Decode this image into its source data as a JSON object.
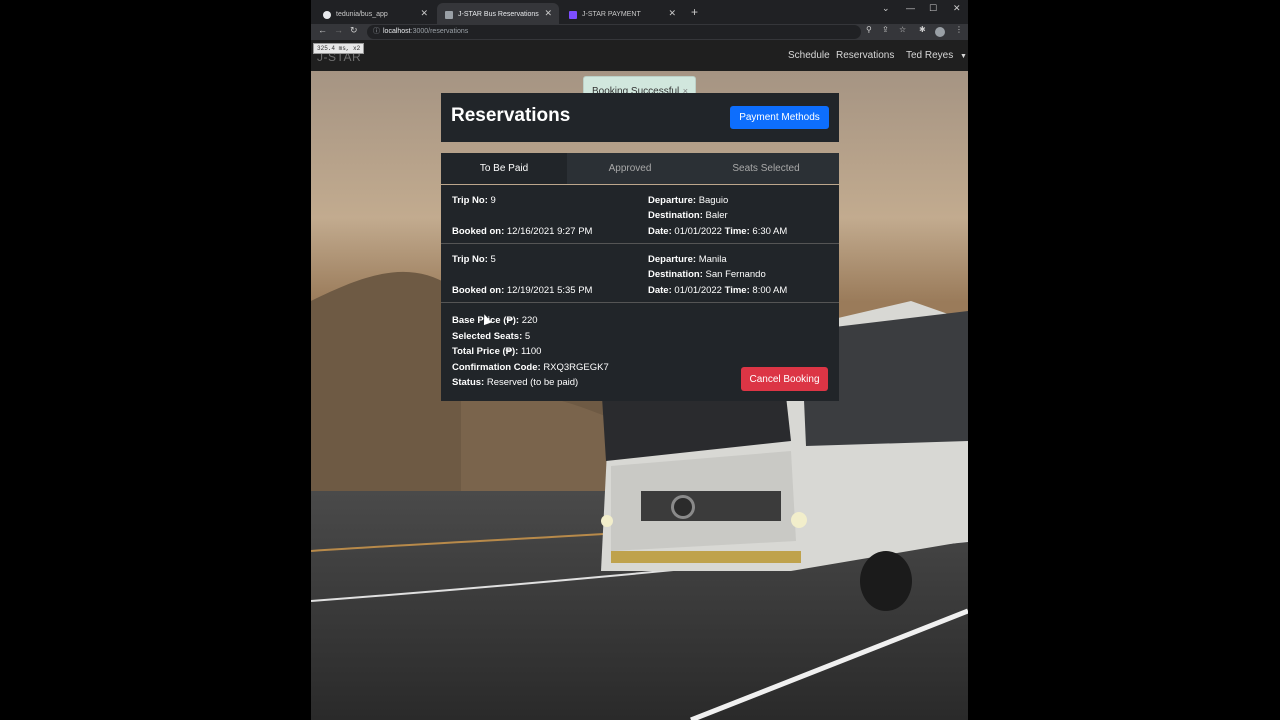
{
  "browser": {
    "tabs": [
      {
        "title": "tedunia/bus_app",
        "icon": "github-icon"
      },
      {
        "title": "J-STAR Bus Reservations",
        "icon": "page-icon"
      },
      {
        "title": "J-STAR PAYMENT",
        "icon": "page-icon"
      }
    ],
    "url_host": "localhost",
    "url_path": ":3000/reservations",
    "perf_badge": "325.4 ms, x2"
  },
  "nav": {
    "brand": "J-STAR",
    "links": [
      "Schedule",
      "Reservations"
    ],
    "user": "Ted Reyes"
  },
  "toast": {
    "message": "Booking Successful",
    "close": "×"
  },
  "reservations": {
    "title": "Reservations",
    "payment_button": "Payment Methods",
    "tabs": [
      "To Be Paid",
      "Approved",
      "Seats Selected"
    ],
    "labels": {
      "trip_no": "Trip No:",
      "booked_on": "Booked on:",
      "departure": "Departure:",
      "destination": "Destination:",
      "date": "Date:",
      "time": "Time:"
    },
    "items": [
      {
        "trip_no": "9",
        "booked_on": "12/16/2021 9:27 PM",
        "departure": "Baguio",
        "destination": "Baler",
        "date": "01/01/2022",
        "time": "6:30 AM"
      },
      {
        "trip_no": "5",
        "booked_on": "12/19/2021 5:35 PM",
        "departure": "Manila",
        "destination": "San Fernando",
        "date": "01/01/2022",
        "time": "8:00 AM"
      }
    ],
    "details": {
      "base_price_label": "Base Price (₱):",
      "base_price": "220",
      "selected_seats_label": "Selected Seats:",
      "selected_seats": "5",
      "total_price_label": "Total Price (₱):",
      "total_price": "1100",
      "confirmation_label": "Confirmation Code:",
      "confirmation_code": "RXQ3RGEGK7",
      "status_label": "Status:",
      "status": "Reserved (to be paid)",
      "cancel_button": "Cancel Booking"
    }
  }
}
